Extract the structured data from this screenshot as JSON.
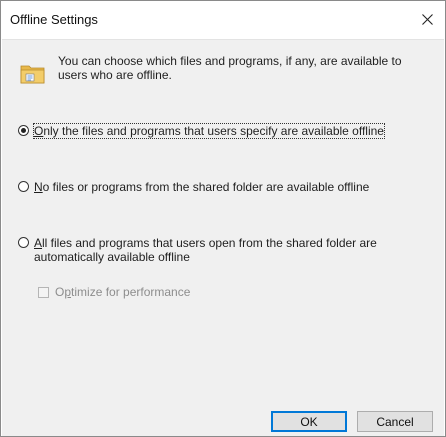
{
  "window": {
    "title": "Offline Settings",
    "close_glyph": "✕"
  },
  "info": {
    "icon": "offline-folder-icon",
    "text": "You can choose which files and programs, if any, are available to users who are offline."
  },
  "options": [
    {
      "accel": "O",
      "rest": "nly the files and programs that users specify are available offline",
      "checked": true,
      "focused": true
    },
    {
      "accel": "N",
      "rest": "o files or programs from the shared folder are available offline",
      "checked": false
    },
    {
      "accel": "A",
      "rest": "ll files and programs that users open from the shared folder are automatically available offline",
      "checked": false
    }
  ],
  "optimize": {
    "label_pre": "O",
    "label_accel": "p",
    "label_rest": "timize for performance",
    "checked": false,
    "enabled": false
  },
  "buttons": {
    "ok": "OK",
    "cancel": "Cancel"
  },
  "colors": {
    "accent": "#0078d7",
    "dialog_bg": "#f0f0f0"
  }
}
